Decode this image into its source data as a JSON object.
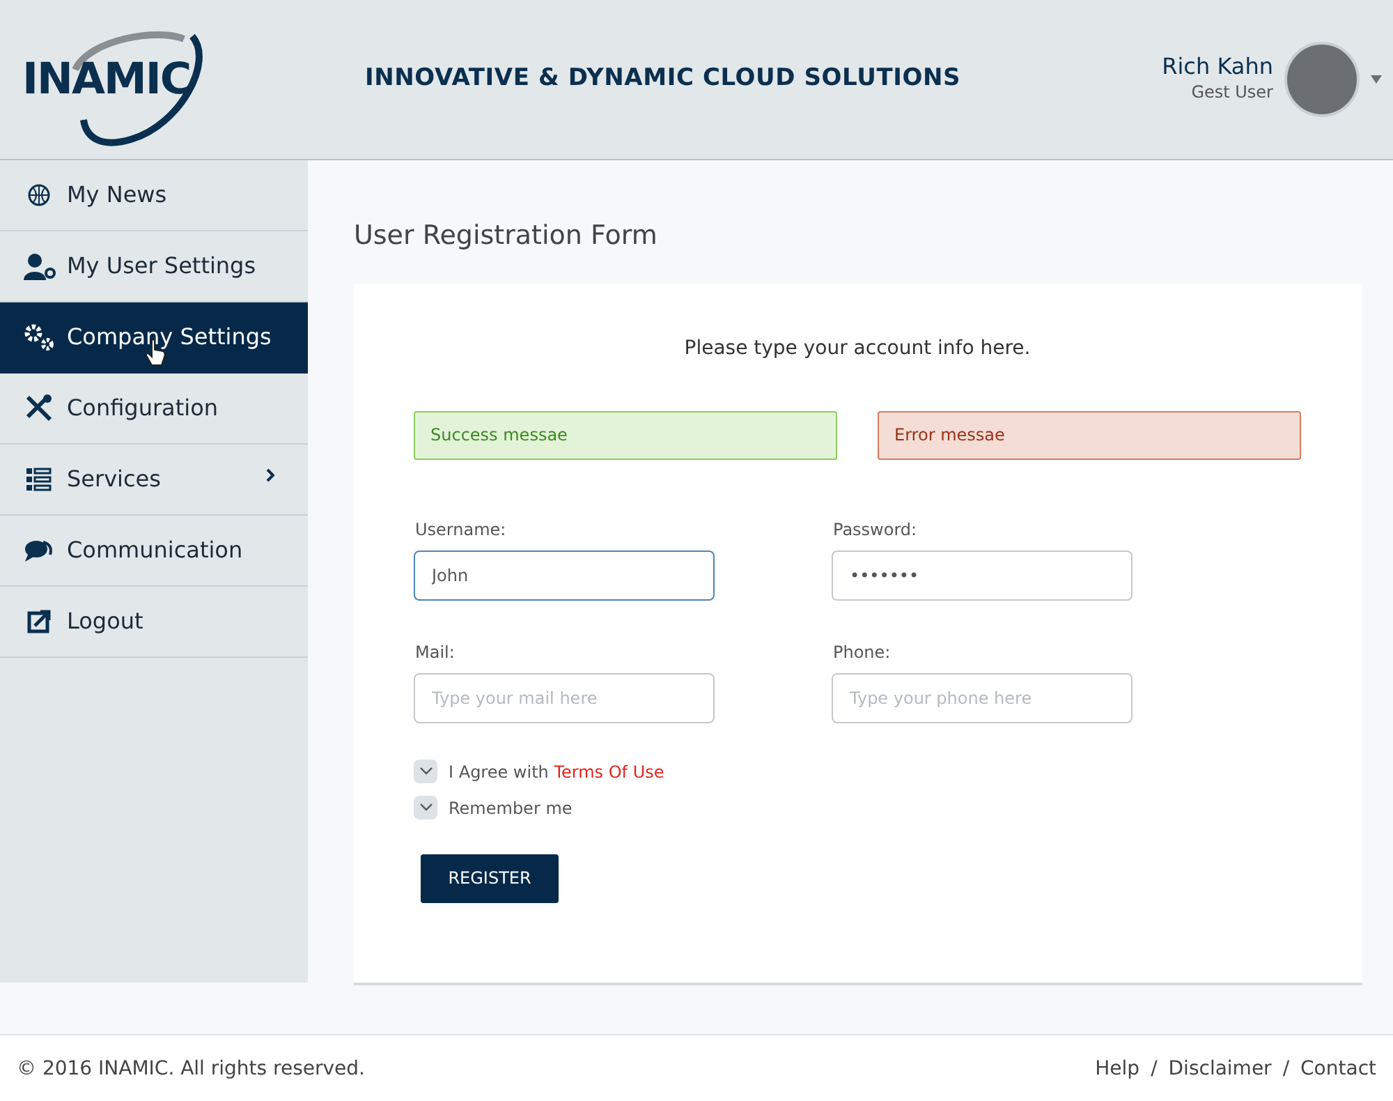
{
  "header": {
    "logo": "INAMIC",
    "tagline": "INNOVATIVE & DYNAMIC CLOUD SOLUTIONS",
    "user": {
      "name": "Rich Kahn",
      "role": "Gest User"
    }
  },
  "sidebar": {
    "items": [
      {
        "label": "My News",
        "selected": false,
        "has_submenu": false
      },
      {
        "label": "My User Settings",
        "selected": false,
        "has_submenu": false
      },
      {
        "label": "Company Settings",
        "selected": true,
        "has_submenu": false
      },
      {
        "label": "Configuration",
        "selected": false,
        "has_submenu": false
      },
      {
        "label": "Services",
        "selected": false,
        "has_submenu": true
      },
      {
        "label": "Communication",
        "selected": false,
        "has_submenu": false
      },
      {
        "label": "Logout",
        "selected": false,
        "has_submenu": false
      }
    ]
  },
  "form": {
    "title": "User Registration Form",
    "intro": "Please type your account info here.",
    "alerts": [
      {
        "kind": "success",
        "text": "Success messae"
      },
      {
        "kind": "error",
        "text": "Error messae"
      }
    ],
    "fields": [
      {
        "label": "Username:",
        "value": "John",
        "focused": true
      },
      {
        "label": "Password:",
        "value": "•••••••",
        "focused": false
      },
      {
        "label": "Mail:",
        "placeholder": "Type your mail here",
        "focused": false
      },
      {
        "label": "Phone:",
        "placeholder": "Type your phone here",
        "focused": false
      }
    ],
    "checkboxes": [
      {
        "label": "I Agree with ",
        "link": "Terms Of Use",
        "checked": true
      },
      {
        "label": "Remember me",
        "checked": true
      }
    ],
    "submit": "REGISTER"
  },
  "footer": {
    "copyright": "© 2016 INAMIC. All rights reserved.",
    "links": [
      "Help",
      "Disclaimer",
      "Contact"
    ],
    "separators": [
      "/",
      "/"
    ]
  }
}
